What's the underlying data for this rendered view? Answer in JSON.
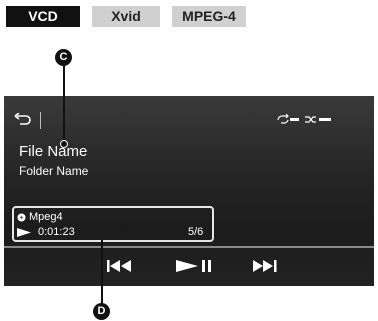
{
  "badges": {
    "vcd": "VCD",
    "xvid": "Xvid",
    "mpeg4": "MPEG-4"
  },
  "callouts": {
    "c": "C",
    "d": "D"
  },
  "header": {
    "back_icon": "back-icon",
    "repeat_icon": "repeat-off-icon",
    "shuffle_icon": "shuffle-all-icon"
  },
  "track": {
    "file_name": "File Name",
    "folder_name": "Folder Name",
    "format": "Mpeg4",
    "elapsed": "0:01:23",
    "position": "5/6"
  },
  "controls": {
    "prev_icon": "previous-track-icon",
    "play_pause_icon": "play-pause-icon",
    "next_icon": "next-track-icon"
  },
  "colors": {
    "screen_bg": "#262626",
    "badge_active": "#111111",
    "badge_inactive": "#d0d0d0",
    "text": "#ffffff"
  }
}
